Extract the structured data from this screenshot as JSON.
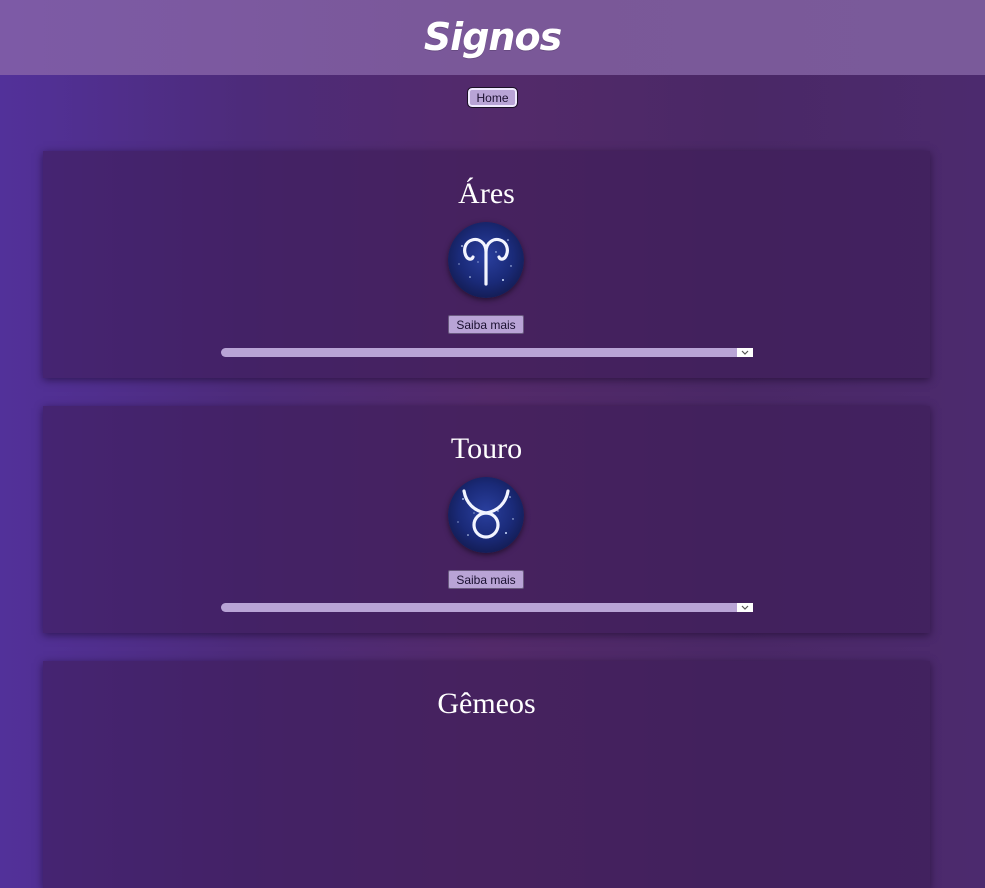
{
  "header": {
    "title": "Signos"
  },
  "nav": {
    "home_label": "Home"
  },
  "signs": [
    {
      "name": "Áres",
      "icon": "aries-icon",
      "button_label": "Saiba mais"
    },
    {
      "name": "Touro",
      "icon": "taurus-icon",
      "button_label": "Saiba mais"
    },
    {
      "name": "Gêmeos"
    }
  ],
  "colors": {
    "header": "#7a5a9a",
    "page_background": "#4c2a6e",
    "button": "#b9a4d6",
    "sign_circle": "#1a2a78"
  }
}
